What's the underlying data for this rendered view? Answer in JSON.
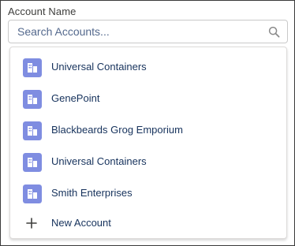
{
  "field": {
    "label": "Account Name",
    "placeholder": "Search Accounts..."
  },
  "icons": {
    "search": "search-icon",
    "account": "account-icon",
    "add": "plus-icon"
  },
  "colors": {
    "account_icon_bg": "#7f8de1",
    "text": "#16325c",
    "border": "#c9c9c9"
  },
  "dropdown": {
    "options": [
      {
        "label": "Universal Containers"
      },
      {
        "label": "GenePoint"
      },
      {
        "label": "Blackbeards Grog Emporium"
      },
      {
        "label": "Universal Containers"
      },
      {
        "label": "Smith Enterprises"
      }
    ],
    "new_label": "New Account"
  }
}
